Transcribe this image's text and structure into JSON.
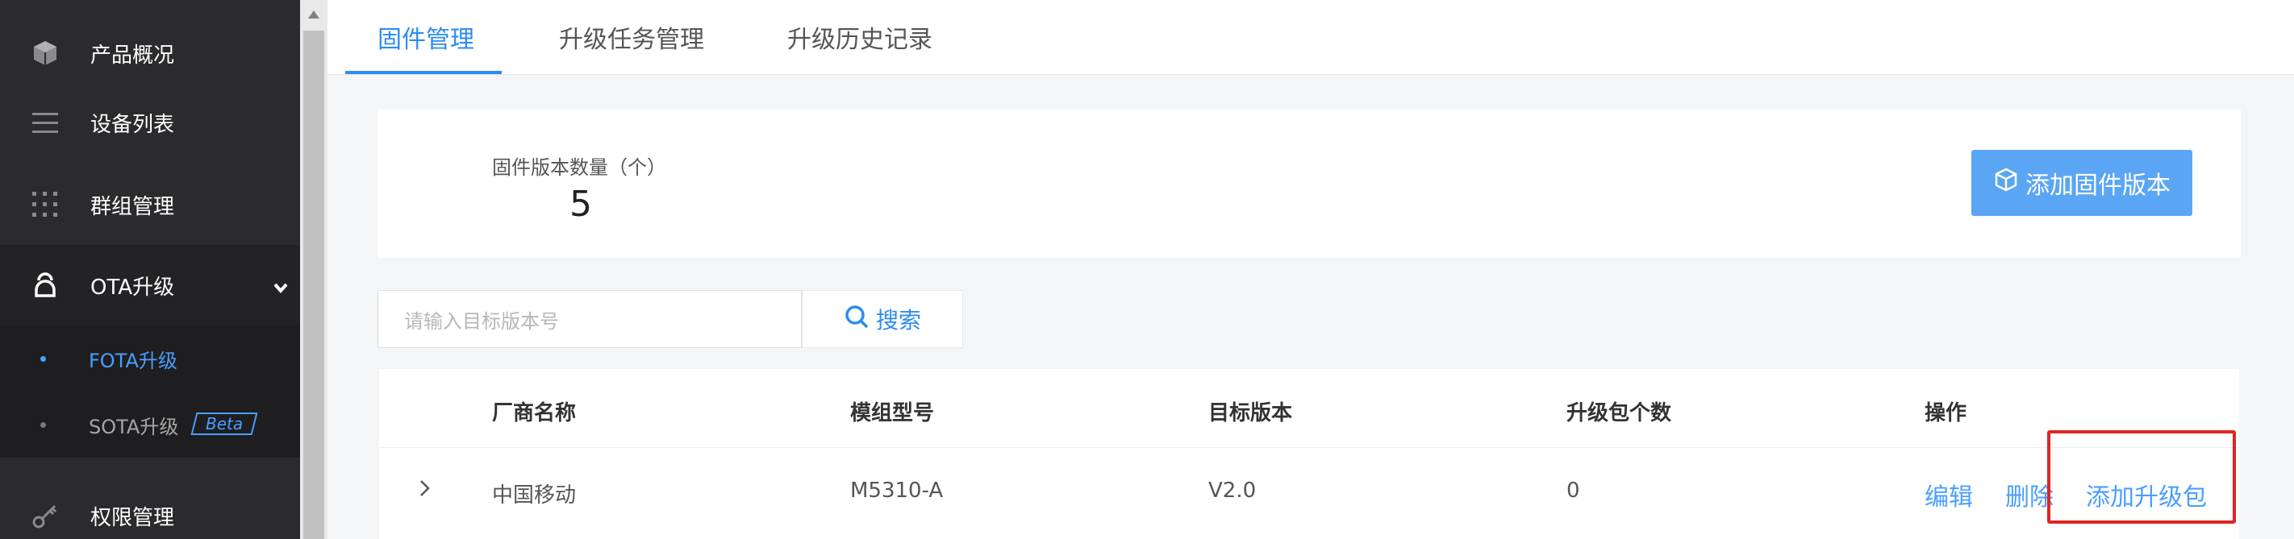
{
  "sidebar": {
    "items": [
      {
        "label": "产品概况",
        "icon": "cube-icon"
      },
      {
        "label": "设备列表",
        "icon": "list-icon"
      },
      {
        "label": "群组管理",
        "icon": "grid-dots-icon"
      },
      {
        "label": "OTA升级",
        "icon": "ota-icon"
      },
      {
        "label": "权限管理",
        "icon": "key-icon"
      }
    ],
    "sub_items": [
      {
        "label": "FOTA升级"
      },
      {
        "label": "SOTA升级",
        "badge": "Beta"
      }
    ]
  },
  "tabs": [
    {
      "label": "固件管理"
    },
    {
      "label": "升级任务管理"
    },
    {
      "label": "升级历史记录"
    }
  ],
  "stats": {
    "label": "固件版本数量（个）",
    "value": "5",
    "add_button": "添加固件版本"
  },
  "search": {
    "placeholder": "请输入目标版本号",
    "button": "搜索"
  },
  "table": {
    "headers": [
      "厂商名称",
      "模组型号",
      "目标版本",
      "升级包个数",
      "操作"
    ],
    "rows": [
      {
        "vendor": "中国移动",
        "model": "M5310-A",
        "version": "V2.0",
        "count": "0",
        "actions": {
          "edit": "编辑",
          "delete": "删除",
          "add_package": "添加升级包"
        }
      }
    ]
  },
  "colors": {
    "accent": "#2d8cf0",
    "sidebar_bg": "#2b2b2d",
    "button_bg": "#5aa6f5",
    "highlight": "#e02424"
  }
}
